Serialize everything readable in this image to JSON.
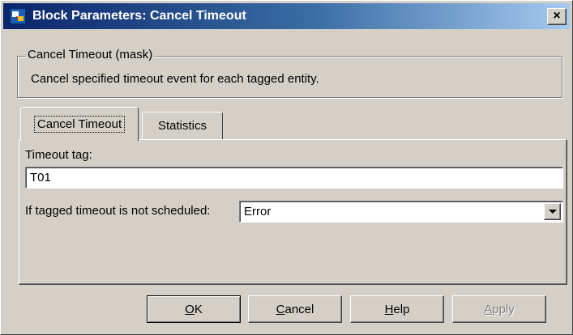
{
  "window": {
    "title": "Block Parameters: Cancel Timeout",
    "icon": "simulink-block-icon",
    "close_label": "×"
  },
  "mask_group": {
    "legend": "Cancel Timeout (mask)",
    "description": "Cancel specified timeout event for each tagged entity."
  },
  "tabs": [
    {
      "label": "Cancel Timeout",
      "active": true
    },
    {
      "label": "Statistics",
      "active": false
    }
  ],
  "params": {
    "timeout_tag_label": "Timeout tag:",
    "timeout_tag_value": "T01",
    "not_scheduled_label": "If tagged timeout is not scheduled:",
    "not_scheduled_value": "Error"
  },
  "buttons": {
    "ok_first": "O",
    "ok_rest": "K",
    "cancel_first": "C",
    "cancel_rest": "ancel",
    "help_first": "H",
    "help_rest": "elp",
    "apply_first": "A",
    "apply_rest": "pply"
  },
  "colors": {
    "titlebar_start": "#0a246a",
    "titlebar_end": "#a6caf0",
    "face": "#d4d0c8"
  }
}
